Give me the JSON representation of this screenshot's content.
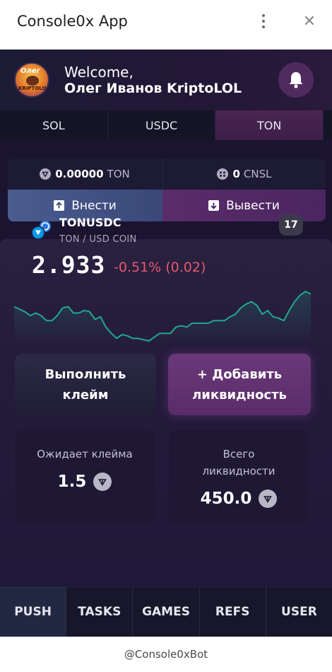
{
  "window": {
    "title": "Console0x App"
  },
  "header": {
    "welcome": "Welcome,",
    "username": "Олег Иванов KriptoLOL",
    "avatar_text_top": "Олег",
    "avatar_text_bottom": "KRIPTOLOL"
  },
  "tabs": [
    {
      "label": "SOL",
      "active": false
    },
    {
      "label": "USDC",
      "active": false
    },
    {
      "label": "TON",
      "active": true
    }
  ],
  "balance": {
    "ton_value": "0.00000",
    "ton_unit": "TON",
    "cnsl_value": "0",
    "cnsl_unit": "CNSL",
    "deposit_label": "Внести",
    "withdraw_label": "Вывести"
  },
  "ticker": {
    "pair": "TONUSDC",
    "subtitle": "TON / USD COIN",
    "price": "2.933",
    "change": "-0.51% (0.02)",
    "badge": "17"
  },
  "actions": {
    "claim_line1": "Выполнить",
    "claim_line2": "клейм",
    "add_line1": "+ Добавить",
    "add_line2": "ликвидность"
  },
  "stats": {
    "pending_label": "Ожидает клейма",
    "pending_value": "1.5",
    "total_label_1": "Всего",
    "total_label_2": "ликвидности",
    "total_value": "450.0"
  },
  "nav": [
    "PUSH",
    "TASKS",
    "GAMES",
    "REFS",
    "USER"
  ],
  "footer": {
    "text": "@Console0xBot"
  },
  "colors": {
    "accent_green": "#1fa98d",
    "negative": "#e55a6b",
    "active_tab": "#4a2452"
  },
  "chart_data": {
    "type": "line",
    "series": [
      {
        "values": [
          2.951,
          2.949,
          2.947,
          2.944,
          2.946,
          2.944,
          2.94,
          2.94,
          2.944,
          2.95,
          2.951,
          2.946,
          2.946,
          2.948,
          2.947,
          2.941,
          2.943,
          2.935,
          2.93,
          2.926,
          2.929,
          2.928,
          2.926,
          2.926,
          2.925,
          2.924,
          2.927,
          2.93,
          2.93,
          2.93,
          2.935,
          2.936,
          2.935,
          2.938,
          2.938,
          2.938,
          2.938,
          2.94,
          2.94,
          2.94,
          2.943,
          2.945,
          2.95,
          2.953,
          2.955,
          2.952,
          2.945,
          2.948,
          2.943,
          2.942,
          2.94,
          2.948,
          2.955,
          2.96,
          2.963,
          2.961
        ]
      }
    ]
  }
}
